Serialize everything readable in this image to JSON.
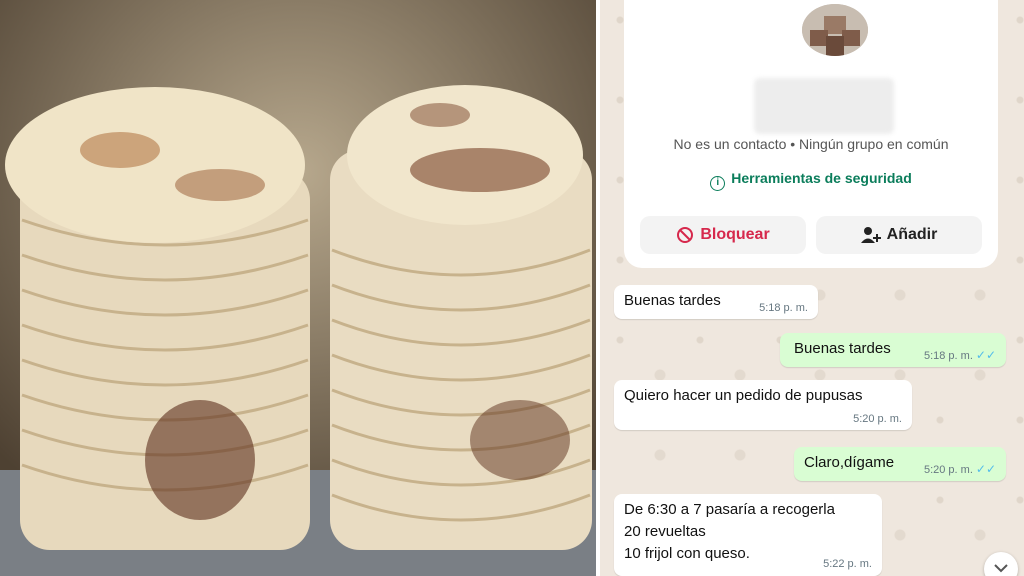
{
  "contact": {
    "meta_text": "No es un contacto • Ningún grupo en común",
    "security_label": "Herramientas de seguridad"
  },
  "actions": {
    "block_label": "Bloquear",
    "add_label": "Añadir"
  },
  "messages": [
    {
      "direction": "in",
      "lines": [
        "Buenas tardes"
      ],
      "time": "5:18 p. m."
    },
    {
      "direction": "out",
      "lines": [
        "Buenas tardes"
      ],
      "time": "5:18 p. m."
    },
    {
      "direction": "in",
      "lines": [
        "Quiero hacer un pedido de pupusas"
      ],
      "time": "5:20 p. m."
    },
    {
      "direction": "out",
      "lines": [
        "Claro,dígame"
      ],
      "time": "5:20 p. m."
    },
    {
      "direction": "in",
      "lines": [
        "De 6:30 a 7 pasaría a recogerla",
        "20 revueltas",
        "10 frijol con queso."
      ],
      "time": "5:22 p. m."
    }
  ],
  "colors": {
    "block_red": "#d6284c",
    "security_green": "#0b7d5b",
    "outgoing_bubble": "#d9fdd3",
    "read_ticks": "#53bdeb"
  },
  "icons": [
    "info-icon",
    "block-icon",
    "add-contact-icon",
    "double-check-icon",
    "chevron-down-icon"
  ]
}
